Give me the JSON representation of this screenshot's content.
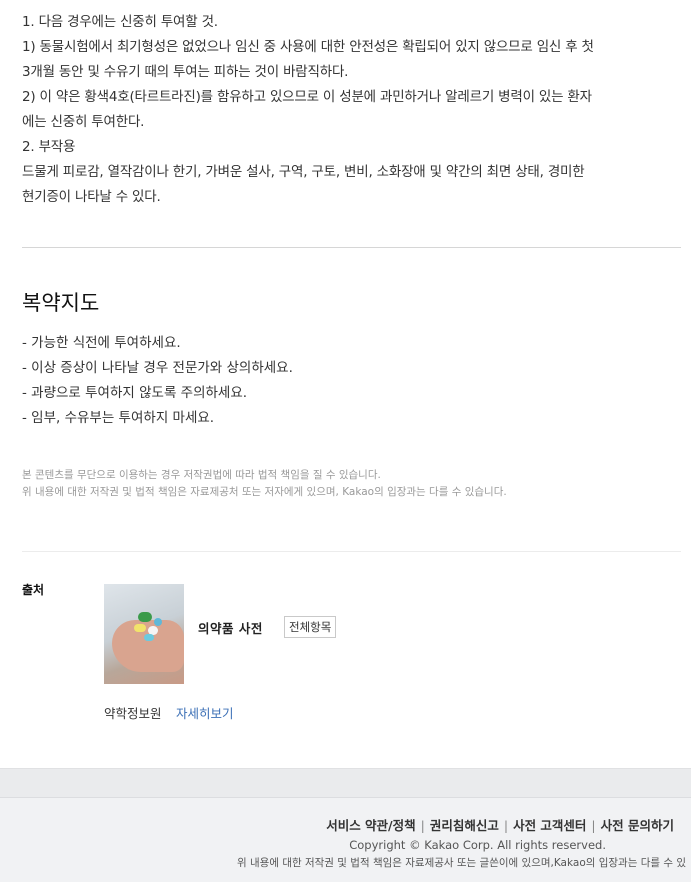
{
  "cautions": [
    "1. 다음 경우에는 신중히 투여할 것.",
    "1) 동물시험에서 최기형성은 없었으나 임신 중 사용에 대한 안전성은 확립되어 있지 않으므로 임신 후 첫",
    "3개월 동안 및 수유기 때의 투여는 피하는 것이 바람직하다.",
    "2) 이 약은 황색4호(타르트라진)를 함유하고 있으므로 이 성분에 과민하거나 알레르기 병력이 있는 환자",
    "에는 신중히 투여한다.",
    "2. 부작용",
    "드물게 피로감, 열작감이나 한기, 가벼운 설사, 구역, 구토, 변비, 소화장애 및 약간의 최면 상태, 경미한",
    "현기증이 나타날 수 있다."
  ],
  "guide": {
    "title": "복약지도",
    "items": [
      "- 가능한 식전에 투여하세요.",
      "- 이상 증상이 나타날 경우 전문가와 상의하세요.",
      "- 과량으로 투여하지 않도록 주의하세요.",
      "- 임부, 수유부는 투여하지 마세요."
    ]
  },
  "copyright_notice": [
    "본 콘텐츠를 무단으로 이용하는 경우 저작권법에 따라 법적 책임을 질 수 있습니다.",
    "위 내용에 대한 저작권 및 법적 책임은 자료제공처 또는 저자에게 있으며, Kakao의 입장과는 다를 수 있습니다."
  ],
  "source": {
    "label": "출처",
    "dictionary_name": "의약품 사전",
    "all_items_button": "전체항목",
    "provider": "약학정보원",
    "detail_link": "자세히보기"
  },
  "footer": {
    "links": [
      "서비스 약관/정책",
      "권리침해신고",
      "사전 고객센터",
      "사전 문의하기"
    ],
    "separator": "|",
    "copyright": "Copyright © Kakao Corp. All rights reserved.",
    "disclaimer": "위 내용에 대한 저작권 및 법적 책임은 자료제공사 또는 글쓴이에 있으며,Kakao의 입장과는 다를 수 있"
  },
  "colors": {
    "link": "#3b6fb6",
    "footer_bg": "#f1f2f4",
    "divider": "#d6d6d6"
  }
}
